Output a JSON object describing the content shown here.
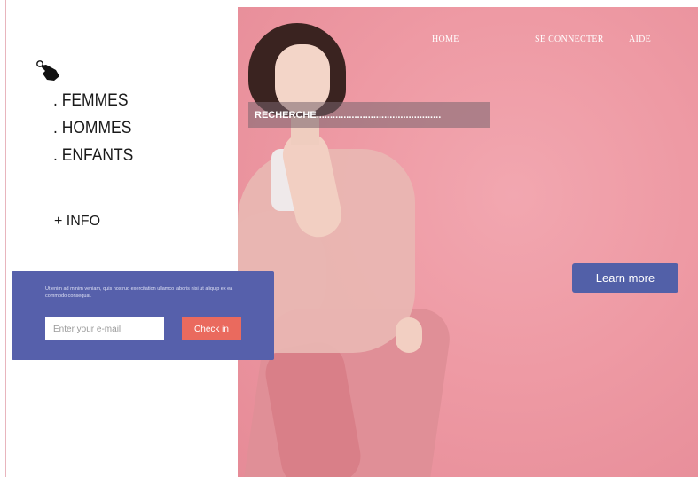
{
  "nav": {
    "home": "HOME",
    "login": "SE CONNECTER",
    "help": "AIDE"
  },
  "search": {
    "label": "RECHERCHE",
    "dots": ".............................................."
  },
  "menu": {
    "items": [
      ". FEMMES",
      ". HOMMES",
      ". ENFANTS"
    ],
    "info": "+ INFO"
  },
  "hero": {
    "cta_label": "Learn more"
  },
  "newsletter": {
    "text": "Ut enim ad minim veniam, quis nostrud exercitation ullamco laboris nisi ut aliquip ex ea commodo consequat.",
    "email_placeholder": "Enter your e-mail",
    "submit_label": "Check in"
  },
  "icons": {
    "cursor": "hand-pointer-icon"
  },
  "colors": {
    "hero_background": "#ee9aa4",
    "newsletter_panel": "#5660ab",
    "cta_button": "#5260a8",
    "checkin_button": "#ea6a5e"
  }
}
